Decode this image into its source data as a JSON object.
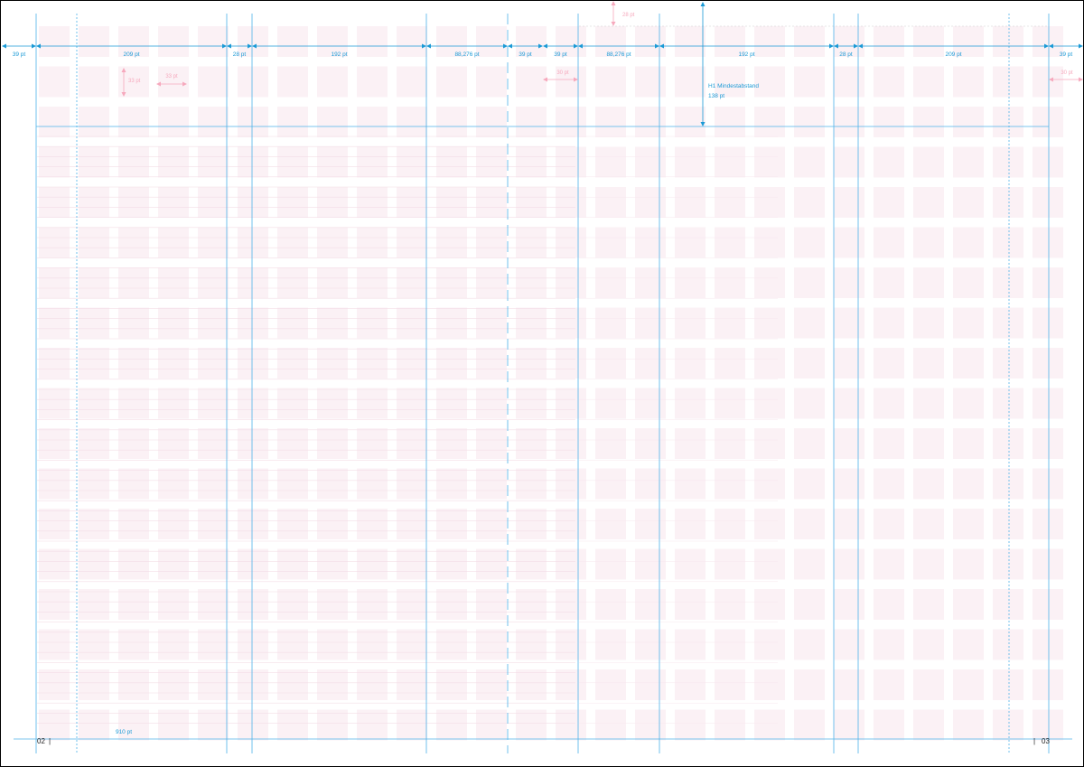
{
  "colors": {
    "guide": "#4fb3ea",
    "guide_dark": "#1a9ad6",
    "module": "#fbf1f5",
    "pink": "#f6a9bd",
    "baseline": "#f3dde6"
  },
  "dimensions": {
    "margin_left": "39 pt",
    "col_left_outer": "209 pt",
    "gutter_left": "28 pt",
    "col_left_main": "192 pt",
    "col_left_inner": "88,276 pt",
    "inner_margin_left": "39 pt",
    "inner_margin_right": "39 pt",
    "col_right_inner": "88,276 pt",
    "col_right_main": "192 pt",
    "gutter_right": "28 pt",
    "col_right_outer": "209 pt",
    "margin_right": "39 pt"
  },
  "pink_labels": {
    "module_height": "33 pt",
    "module_width": "33 pt",
    "top_offset": "28 pt",
    "inner_offset": "30 pt",
    "outer_offset": "30 pt"
  },
  "h1": {
    "label": "H1 Mindestabstand",
    "value": "138 pt"
  },
  "bottom_label": "910 pt",
  "page_numbers": {
    "left": "02",
    "right": "03"
  }
}
